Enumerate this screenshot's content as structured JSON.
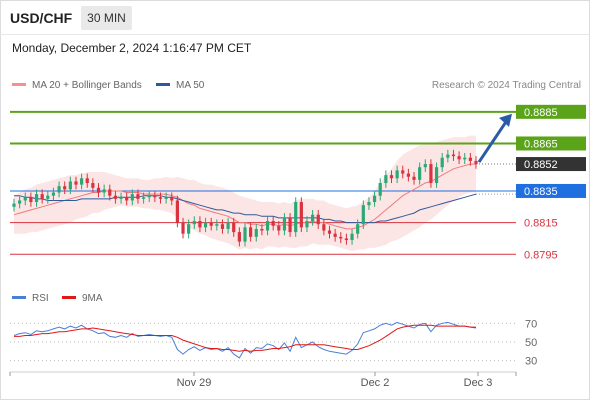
{
  "header": {
    "symbol": "USD/CHF",
    "timeframe": "30 MIN",
    "datetime": "Monday, December 2, 2024 1:16:47 PM CET"
  },
  "legend": {
    "ma20_label": "MA 20 + Bollinger Bands",
    "ma50_label": "MA 50",
    "rsi_label": "RSI",
    "ma9_label": "9MA"
  },
  "credit": "Research © 2024 Trading Central",
  "colors": {
    "bull": "#2aa876",
    "bear": "#d9333f",
    "green_level": "#5ba319",
    "blue_level": "#1f6fe0",
    "last_price": "#333333",
    "ma20": "#f07a7a",
    "ma50": "#2e5a9c",
    "bollinger_fill": "#fbe0e0",
    "arrow": "#2a5ba8"
  },
  "chart_data": [
    {
      "type": "candlestick",
      "title": "USD/CHF",
      "timeframe": "30 MIN",
      "x_tick_labels": [
        "Nov 29",
        "Dec 2",
        "Dec 3"
      ],
      "y_range": [
        0.878,
        0.8895
      ],
      "last_price": 0.8852,
      "levels": [
        {
          "value": 0.8885,
          "kind": "resistance",
          "label": "0.8885"
        },
        {
          "value": 0.8865,
          "kind": "resistance",
          "label": "0.8865"
        },
        {
          "value": 0.8835,
          "kind": "pivot",
          "label": "0.8835"
        },
        {
          "value": 0.8815,
          "kind": "support",
          "label": "0.8815"
        },
        {
          "value": 0.8795,
          "kind": "support",
          "label": "0.8795"
        }
      ],
      "last_price_label": "0.8852",
      "projection": {
        "from": 0.8852,
        "to": 0.8885
      },
      "close": [
        0.8827,
        0.8829,
        0.8831,
        0.8828,
        0.8833,
        0.883,
        0.8832,
        0.8834,
        0.8838,
        0.8836,
        0.8841,
        0.8839,
        0.8843,
        0.884,
        0.8837,
        0.8834,
        0.8836,
        0.8832,
        0.883,
        0.8831,
        0.8829,
        0.8833,
        0.883,
        0.8831,
        0.8832,
        0.8831,
        0.883,
        0.8831,
        0.8829,
        0.8815,
        0.8808,
        0.8814,
        0.8816,
        0.8812,
        0.8815,
        0.8813,
        0.8814,
        0.8811,
        0.8815,
        0.8809,
        0.8803,
        0.8812,
        0.8806,
        0.8811,
        0.881,
        0.8816,
        0.8813,
        0.881,
        0.8818,
        0.8809,
        0.8828,
        0.8812,
        0.8816,
        0.882,
        0.8814,
        0.881,
        0.8808,
        0.8806,
        0.8805,
        0.8804,
        0.8808,
        0.8814,
        0.8826,
        0.8828,
        0.8832,
        0.884,
        0.8845,
        0.8843,
        0.8848,
        0.8846,
        0.8844,
        0.8842,
        0.885,
        0.8852,
        0.884,
        0.885,
        0.8856,
        0.8858,
        0.8857,
        0.8855,
        0.8856,
        0.8854,
        0.8852
      ],
      "ma20": [
        0.882,
        0.8821,
        0.8822,
        0.8823,
        0.8824,
        0.8825,
        0.8826,
        0.8827,
        0.8828,
        0.8829,
        0.883,
        0.8831,
        0.8832,
        0.8833,
        0.8834,
        0.8834,
        0.8835,
        0.8835,
        0.8835,
        0.8835,
        0.8834,
        0.8834,
        0.8834,
        0.8833,
        0.8833,
        0.8833,
        0.8833,
        0.8833,
        0.8832,
        0.8831,
        0.8829,
        0.8827,
        0.8826,
        0.8824,
        0.8823,
        0.8822,
        0.8821,
        0.882,
        0.8819,
        0.8817,
        0.8815,
        0.8815,
        0.8814,
        0.8814,
        0.8813,
        0.8814,
        0.8814,
        0.8813,
        0.8814,
        0.8813,
        0.8814,
        0.8815,
        0.8815,
        0.8816,
        0.8815,
        0.8815,
        0.8814,
        0.8813,
        0.8812,
        0.8811,
        0.8811,
        0.8812,
        0.8813,
        0.8815,
        0.8817,
        0.882,
        0.8823,
        0.8826,
        0.8829,
        0.8832,
        0.8834,
        0.8836,
        0.8838,
        0.884,
        0.8841,
        0.8843,
        0.8845,
        0.8847,
        0.8849,
        0.885,
        0.8851,
        0.8852,
        0.8852
      ],
      "ma50": [
        0.8832,
        0.8832,
        0.8831,
        0.8831,
        0.883,
        0.883,
        0.8829,
        0.8829,
        0.8829,
        0.8829,
        0.8829,
        0.8829,
        0.883,
        0.883,
        0.883,
        0.883,
        0.883,
        0.883,
        0.8831,
        0.8831,
        0.8831,
        0.8831,
        0.8831,
        0.8832,
        0.8832,
        0.8832,
        0.8832,
        0.8831,
        0.8831,
        0.883,
        0.8829,
        0.8828,
        0.8827,
        0.8826,
        0.8825,
        0.8824,
        0.8823,
        0.8823,
        0.8822,
        0.8821,
        0.8821,
        0.882,
        0.882,
        0.882,
        0.8819,
        0.8819,
        0.8819,
        0.8818,
        0.8818,
        0.8818,
        0.8818,
        0.8818,
        0.8818,
        0.8818,
        0.8818,
        0.8817,
        0.8817,
        0.8816,
        0.8816,
        0.8815,
        0.8815,
        0.8815,
        0.8815,
        0.8815,
        0.8815,
        0.8816,
        0.8816,
        0.8817,
        0.8818,
        0.8819,
        0.882,
        0.8821,
        0.8823,
        0.8824,
        0.8825,
        0.8826,
        0.8827,
        0.8828,
        0.8829,
        0.883,
        0.8831,
        0.8832,
        0.8833
      ],
      "bollinger_width": [
        0.0012,
        0.0013,
        0.0014,
        0.0014,
        0.0015,
        0.0015,
        0.0015,
        0.0015,
        0.0015,
        0.0015,
        0.0015,
        0.0014,
        0.0014,
        0.0014,
        0.0013,
        0.0013,
        0.0012,
        0.0011,
        0.001,
        0.0009,
        0.0009,
        0.0009,
        0.0009,
        0.0009,
        0.0009,
        0.001,
        0.001,
        0.0011,
        0.0011,
        0.0013,
        0.0014,
        0.0015,
        0.0016,
        0.0016,
        0.0016,
        0.0017,
        0.0017,
        0.0017,
        0.0017,
        0.0017,
        0.0017,
        0.0016,
        0.0016,
        0.0015,
        0.0015,
        0.0014,
        0.0014,
        0.0014,
        0.0014,
        0.0014,
        0.0015,
        0.0015,
        0.0015,
        0.0014,
        0.0014,
        0.0014,
        0.0013,
        0.0013,
        0.0013,
        0.0013,
        0.0014,
        0.0014,
        0.0015,
        0.0016,
        0.0018,
        0.002,
        0.0022,
        0.0023,
        0.0025,
        0.0026,
        0.0026,
        0.0026,
        0.0026,
        0.0025,
        0.0024,
        0.0023,
        0.0022,
        0.0021,
        0.002,
        0.0019,
        0.0018,
        0.0018,
        0.0018
      ]
    },
    {
      "type": "line",
      "title": "RSI",
      "y_range": [
        20,
        80
      ],
      "y_ticks": [
        70,
        50,
        30
      ],
      "series": [
        {
          "name": "RSI",
          "values": [
            57,
            59,
            60,
            58,
            62,
            61,
            62,
            64,
            66,
            64,
            67,
            65,
            68,
            64,
            62,
            59,
            60,
            56,
            55,
            57,
            55,
            59,
            56,
            57,
            58,
            57,
            56,
            57,
            55,
            42,
            37,
            42,
            45,
            41,
            44,
            42,
            43,
            40,
            44,
            37,
            33,
            43,
            38,
            44,
            43,
            48,
            46,
            42,
            49,
            40,
            55,
            44,
            47,
            50,
            45,
            42,
            40,
            39,
            38,
            37,
            41,
            48,
            60,
            62,
            64,
            68,
            70,
            68,
            71,
            69,
            67,
            65,
            69,
            70,
            61,
            68,
            70,
            71,
            69,
            67,
            67,
            66,
            65
          ]
        },
        {
          "name": "9MA",
          "values": [
            56,
            56,
            57,
            57,
            58,
            59,
            59,
            60,
            61,
            61,
            62,
            63,
            64,
            64,
            65,
            64,
            63,
            62,
            61,
            60,
            59,
            58,
            57,
            57,
            57,
            57,
            57,
            57,
            57,
            55,
            52,
            50,
            48,
            46,
            44,
            43,
            43,
            42,
            42,
            41,
            40,
            41,
            40,
            41,
            41,
            42,
            43,
            43,
            44,
            45,
            47,
            47,
            47,
            47,
            47,
            47,
            46,
            45,
            44,
            43,
            42,
            42,
            44,
            46,
            49,
            52,
            56,
            60,
            64,
            66,
            67,
            68,
            68,
            68,
            68,
            67,
            67,
            67,
            67,
            67,
            67,
            66,
            66
          ]
        }
      ]
    }
  ]
}
